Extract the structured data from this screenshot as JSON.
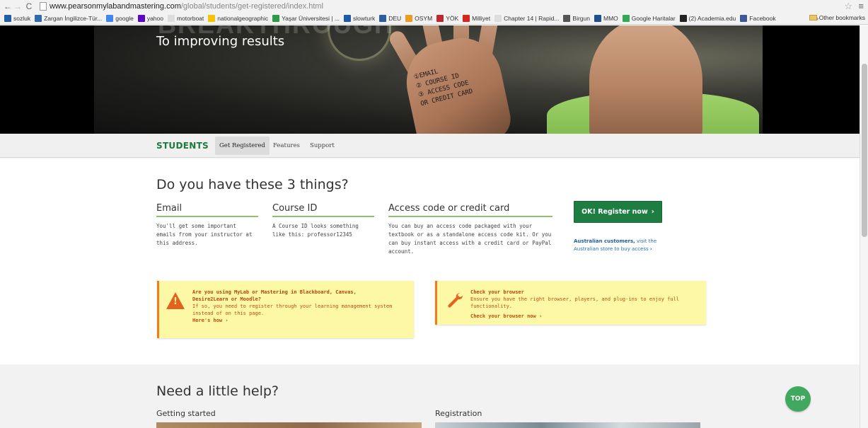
{
  "browser": {
    "url_host": "www.pearsonmylabandmastering.com",
    "url_path": "/global/students/get-registered/index.html",
    "bookmarks": [
      {
        "label": "sozluk",
        "color": "#1e5fa8"
      },
      {
        "label": "Zargan İngilizce-Tür...",
        "color": "#2d6ab0"
      },
      {
        "label": "google",
        "color": "#4285f4"
      },
      {
        "label": "yahoo",
        "color": "#5f01d1"
      },
      {
        "label": "motorboat",
        "color": "#dddddd"
      },
      {
        "label": "nationalgeographic",
        "color": "#f5c400"
      },
      {
        "label": "Yaşar Üniversitesi | ...",
        "color": "#2e9a45"
      },
      {
        "label": "slowturk",
        "color": "#1e5aa8"
      },
      {
        "label": "DEU",
        "color": "#2a5ea0"
      },
      {
        "label": "OSYM",
        "color": "#f29a1e"
      },
      {
        "label": "YÖK",
        "color": "#c0262d"
      },
      {
        "label": "Milliyet",
        "color": "#d9261c"
      },
      {
        "label": "Chapter 14 | Rapid...",
        "color": "#dddddd"
      },
      {
        "label": "Birgun",
        "color": "#555555"
      },
      {
        "label": "MMO",
        "color": "#1d4f91"
      },
      {
        "label": "Google Haritalar",
        "color": "#34a853"
      },
      {
        "label": "(2) Academia.edu",
        "color": "#222222"
      },
      {
        "label": "Facebook",
        "color": "#3b5998"
      }
    ],
    "overflow_label": "»",
    "other_bookmarks": "Other bookmarks"
  },
  "hero": {
    "title_big": "BREAKTHROUGH",
    "subtitle": "To improving results",
    "hand_notes": [
      "①EMAIL",
      "② COURSE ID",
      "③ ACCESS CODE",
      "OR CREDIT CARD"
    ]
  },
  "subnav": {
    "brand": "STUDENTS",
    "tabs": [
      "Get Registered",
      "Features",
      "Support"
    ]
  },
  "main": {
    "title": "Do you have these 3 things?",
    "columns": [
      {
        "heading": "Email",
        "text": [
          "You'll get some important",
          "emails from your instructor at",
          "this address."
        ]
      },
      {
        "heading": "Course ID",
        "text": [
          "A Course ID looks something",
          "like this: professor12345"
        ]
      },
      {
        "heading": "Access code or credit card",
        "text": [
          "You can buy an access code packaged with your",
          "textbook or as a standalone access code kit. Or you",
          "can buy instant access with a credit card or PayPal",
          "account."
        ]
      }
    ],
    "register_label": "OK! Register now",
    "register_chevron": "›",
    "aus_bold": "Australian customers,",
    "aus_rest": " visit the",
    "aus_line2": "Australian store to buy access",
    "aus_chevron": "›"
  },
  "alerts": {
    "lms": {
      "title": [
        "Are you using MyLab or Mastering in Blackboard, Canvas,",
        "Desire2Learn or Moodle?"
      ],
      "text": [
        "If so, you need to register through your learning management system",
        "instead of on this page."
      ],
      "link": "Here's how",
      "link_chevron": "›"
    },
    "browser": {
      "title": "Check your browser",
      "text": "Ensure you have the right browser, players, and plug-ins to enjoy full functionality.",
      "link": "Check your browser now",
      "link_chevron": "›"
    }
  },
  "help": {
    "title": "Need a little help?",
    "getting_started": "Getting started",
    "registration": "Registration",
    "top_label": "TOP"
  },
  "colors": {
    "brand_green": "#1a7b3c",
    "button_green": "#1d7d42",
    "alert_yellow": "#fdf8a6",
    "alert_orange": "#f07d1c",
    "link_blue": "#2a6fb5"
  }
}
